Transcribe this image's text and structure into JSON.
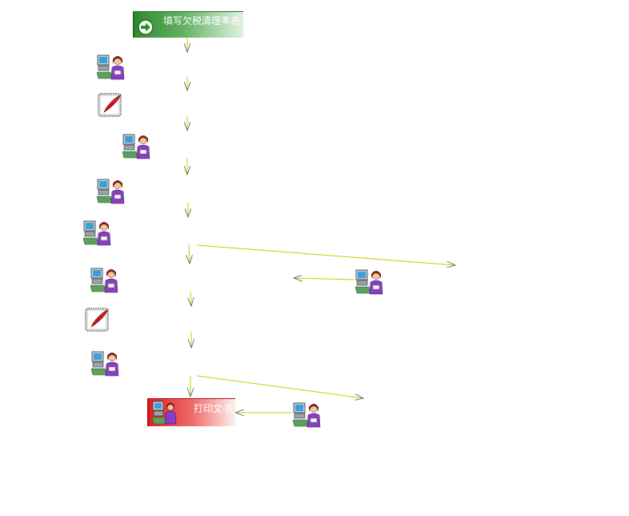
{
  "flow": {
    "start_label": "填写欠税清理率表",
    "end_label": "打印文书"
  },
  "icons": {
    "start": "arrow-right-icon",
    "person": "user-at-computer-icon",
    "note": "notepad-feather-icon"
  },
  "colors": {
    "start_fill": "#3f9a3f",
    "end_fill": "#e43333",
    "arrow_stroke": "#c8c800"
  }
}
